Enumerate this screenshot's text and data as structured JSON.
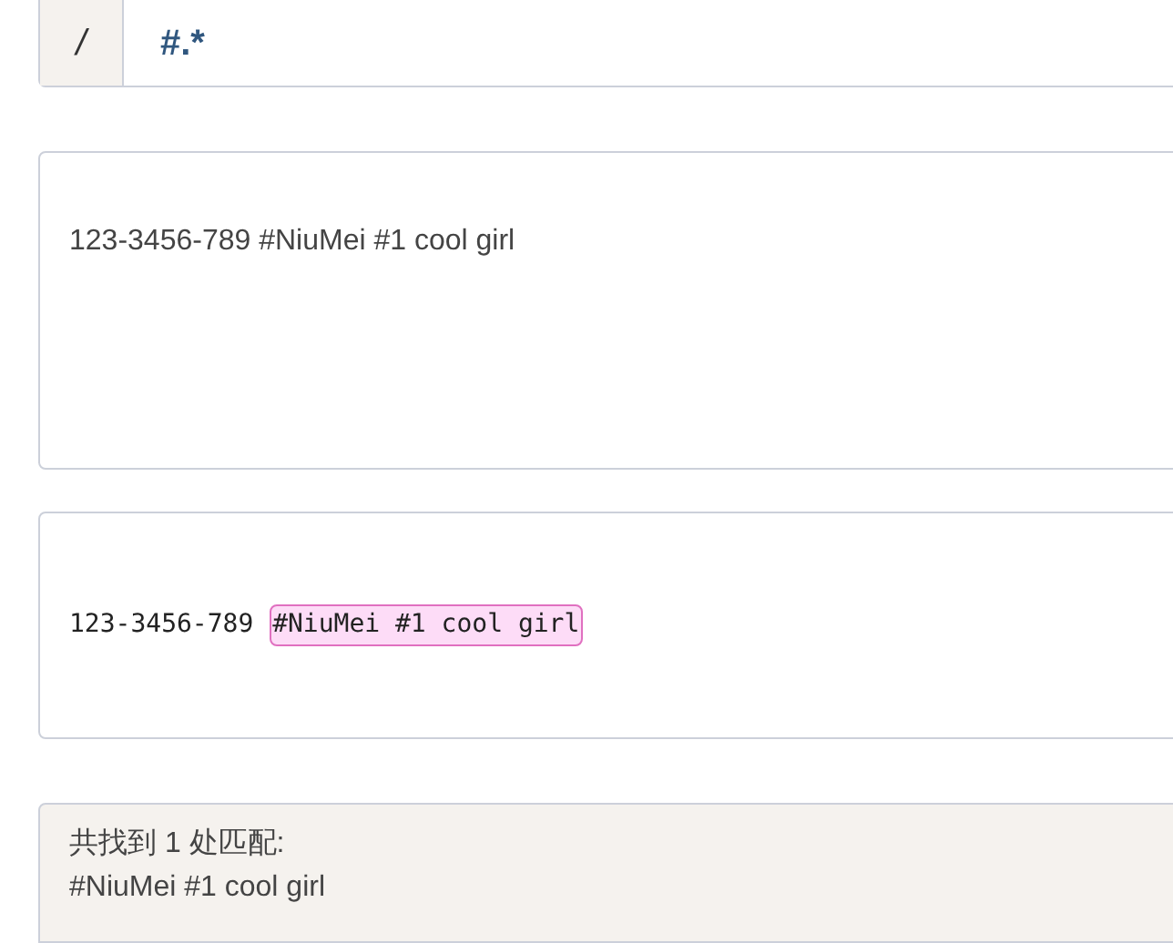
{
  "regex_bar": {
    "delimiter": "/",
    "pattern": "#.*"
  },
  "test_text": {
    "value": "123-3456-789 #NiuMei #1 cool girl"
  },
  "result": {
    "segments": [
      {
        "text": "123-3456-789 ",
        "highlighted": false
      },
      {
        "text": "#NiuMei #1 cool girl",
        "highlighted": true
      }
    ]
  },
  "summary": {
    "heading": "共找到 1 处匹配:",
    "matches": [
      "#NiuMei #1 cool girl"
    ]
  }
}
